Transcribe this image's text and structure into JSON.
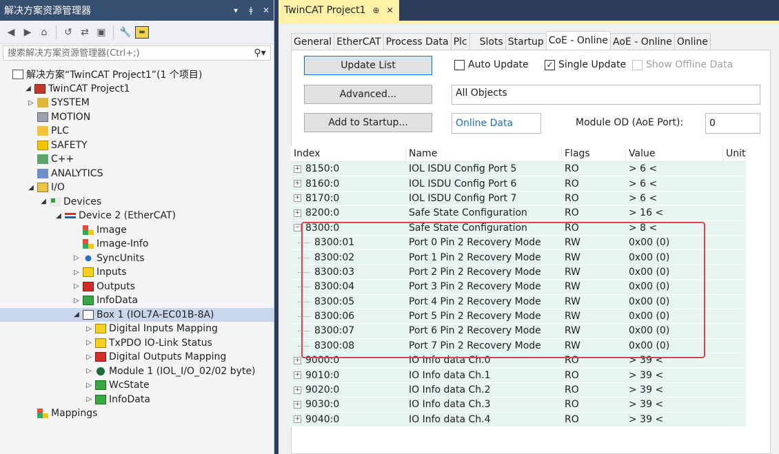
{
  "left_panel": {
    "title": "解决方案资源管理器",
    "controls": {
      "dropdown": "▾",
      "pin": "ǂ",
      "close": "✕"
    },
    "search_placeholder": "搜索解决方案资源管理器(Ctrl+;)",
    "tree": [
      {
        "label": "解决方案“TwinCAT Project1”(1 个项目)",
        "level": 0,
        "arrow": "",
        "icon": "solution-icon"
      },
      {
        "label": "TwinCAT Project1",
        "level": 1,
        "arrow": "◢",
        "icon": "project-icon"
      },
      {
        "label": "SYSTEM",
        "level": 2,
        "arrow": "▷",
        "icon": "system-icon"
      },
      {
        "label": "MOTION",
        "level": 2,
        "arrow": "",
        "icon": "motion-icon"
      },
      {
        "label": "PLC",
        "level": 2,
        "arrow": "",
        "icon": "plc-icon"
      },
      {
        "label": "SAFETY",
        "level": 2,
        "arrow": "",
        "icon": "safety-icon"
      },
      {
        "label": "C++",
        "level": 2,
        "arrow": "",
        "icon": "cpp-icon"
      },
      {
        "label": "ANALYTICS",
        "level": 2,
        "arrow": "",
        "icon": "analytics-icon"
      },
      {
        "label": "I/O",
        "level": 2,
        "arrow": "◢",
        "icon": "io-icon"
      },
      {
        "label": "Devices",
        "level": 3,
        "arrow": "◢",
        "icon": "devices-icon"
      },
      {
        "label": "Device 2 (EtherCAT)",
        "level": 4,
        "arrow": "◢",
        "icon": "ethercat-device-icon"
      },
      {
        "label": "Image",
        "level": 5,
        "arrow": "",
        "icon": "image-icon"
      },
      {
        "label": "Image-Info",
        "level": 5,
        "arrow": "",
        "icon": "image-info-icon"
      },
      {
        "label": "SyncUnits",
        "level": 5,
        "arrow": "▷",
        "icon": "syncunits-icon"
      },
      {
        "label": "Inputs",
        "level": 5,
        "arrow": "▷",
        "icon": "inputs-icon"
      },
      {
        "label": "Outputs",
        "level": 5,
        "arrow": "▷",
        "icon": "outputs-icon"
      },
      {
        "label": "InfoData",
        "level": 5,
        "arrow": "▷",
        "icon": "infodata-icon"
      },
      {
        "label": "Box 1 (IOL7A-EC01B-8A)",
        "level": 5,
        "arrow": "◢",
        "icon": "box-icon",
        "selected": true
      },
      {
        "label": "Digital Inputs Mapping",
        "level": 6,
        "arrow": "▷",
        "icon": "inputs-mapping-icon"
      },
      {
        "label": "TxPDO IO-Link Status",
        "level": 6,
        "arrow": "▷",
        "icon": "txpdo-icon"
      },
      {
        "label": "Digital Outputs Mapping",
        "level": 6,
        "arrow": "▷",
        "icon": "outputs-mapping-icon"
      },
      {
        "label": "Module 1 (IOL_I/O_02/02 byte)",
        "level": 6,
        "arrow": "▷",
        "icon": "module-icon"
      },
      {
        "label": "WcState",
        "level": 6,
        "arrow": "▷",
        "icon": "wcstate-icon"
      },
      {
        "label": "InfoData",
        "level": 6,
        "arrow": "▷",
        "icon": "infodata-icon"
      },
      {
        "label": "Mappings",
        "level": 2,
        "arrow": "",
        "icon": "mappings-icon"
      }
    ]
  },
  "doc_tab": {
    "title": "TwinCAT Project1",
    "pin": "⊕",
    "close": "✕"
  },
  "tabs": [
    "General",
    "EtherCAT",
    "Process Data",
    "Plc",
    "Slots",
    "Startup",
    "CoE - Online",
    "AoE - Online",
    "Online"
  ],
  "active_tab": "CoE - Online",
  "controls": {
    "update_list": "Update List",
    "advanced": "Advanced...",
    "add_to_startup": "Add to Startup...",
    "auto_update": "Auto Update",
    "single_update": "Single Update",
    "show_offline": "Show Offline Data",
    "all_objects": "All Objects",
    "online_data": "Online Data",
    "module_od_label": "Module OD (AoE Port):",
    "module_od_value": "0"
  },
  "table": {
    "columns": [
      "Index",
      "Name",
      "Flags",
      "Value",
      "Unit"
    ],
    "rows": [
      {
        "index": "8150:0",
        "name": "IOL ISDU Config Port 5",
        "flags": "RO",
        "value": "> 6 <",
        "type": "plus"
      },
      {
        "index": "8160:0",
        "name": "IOL ISDU Config Port 6",
        "flags": "RO",
        "value": "> 6 <",
        "type": "plus"
      },
      {
        "index": "8170:0",
        "name": "IOL ISDU Config Port 7",
        "flags": "RO",
        "value": "> 6 <",
        "type": "plus"
      },
      {
        "index": "8200:0",
        "name": "Safe State Configuration",
        "flags": "RO",
        "value": "> 16 <",
        "type": "plus"
      },
      {
        "index": "8300:0",
        "name": "Safe State Configuration",
        "flags": "RO",
        "value": "> 8 <",
        "type": "minus"
      },
      {
        "index": "8300:01",
        "name": "Port 0 Pin 2 Recovery Mode",
        "flags": "RW",
        "value": "0x00 (0)",
        "type": "sub"
      },
      {
        "index": "8300:02",
        "name": "Port 1 Pin 2 Recovery Mode",
        "flags": "RW",
        "value": "0x00 (0)",
        "type": "sub"
      },
      {
        "index": "8300:03",
        "name": "Port 2 Pin 2 Recovery Mode",
        "flags": "RW",
        "value": "0x00 (0)",
        "type": "sub"
      },
      {
        "index": "8300:04",
        "name": "Port 3 Pin 2 Recovery Mode",
        "flags": "RW",
        "value": "0x00 (0)",
        "type": "sub"
      },
      {
        "index": "8300:05",
        "name": "Port 4 Pin 2 Recovery Mode",
        "flags": "RW",
        "value": "0x00 (0)",
        "type": "sub"
      },
      {
        "index": "8300:06",
        "name": "Port 5 Pin 2 Recovery Mode",
        "flags": "RW",
        "value": "0x00 (0)",
        "type": "sub"
      },
      {
        "index": "8300:07",
        "name": "Port 6 Pin 2 Recovery Mode",
        "flags": "RW",
        "value": "0x00 (0)",
        "type": "sub"
      },
      {
        "index": "8300:08",
        "name": "Port 7 Pin 2 Recovery Mode",
        "flags": "RW",
        "value": "0x00 (0)",
        "type": "sub"
      },
      {
        "index": "9000:0",
        "name": "IO Info data Ch.0",
        "flags": "RO",
        "value": "> 39 <",
        "type": "plus"
      },
      {
        "index": "9010:0",
        "name": "IO Info data Ch.1",
        "flags": "RO",
        "value": "> 39 <",
        "type": "plus"
      },
      {
        "index": "9020:0",
        "name": "IO Info data Ch.2",
        "flags": "RO",
        "value": "> 39 <",
        "type": "plus"
      },
      {
        "index": "9030:0",
        "name": "IO Info data Ch.3",
        "flags": "RO",
        "value": "> 39 <",
        "type": "plus"
      },
      {
        "index": "9040:0",
        "name": "IO Info data Ch.4",
        "flags": "RO",
        "value": "> 39 <",
        "type": "plus"
      }
    ]
  },
  "colors": {
    "accent": "#fff1a8",
    "highlight": "#e0414a",
    "row_bg": "#e6f5f2",
    "title_bar": "#364e6f"
  }
}
